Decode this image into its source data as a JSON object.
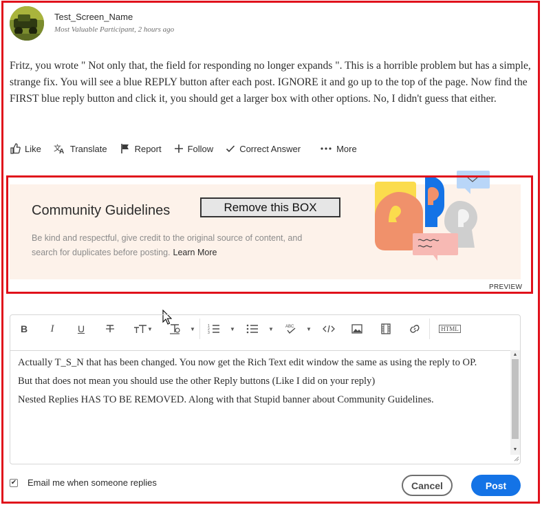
{
  "post": {
    "author": "Test_Screen_Name",
    "rank": "Most Valuable Participant",
    "time": ", 2 hours ago",
    "body": "Fritz, you wrote \" Not only that, the field for responding no longer expands \". This is a horrible problem but has a simple, strange fix. You will see a blue REPLY button after each post. IGNORE it and go up to the top of the page. Now find the FIRST blue reply button and click it, you should get a larger box with other options. No, I didn't guess that either."
  },
  "actions": {
    "like": "Like",
    "translate": "Translate",
    "report": "Report",
    "follow": "Follow",
    "correct_answer": "Correct Answer",
    "more": "More"
  },
  "guidelines": {
    "title": "Community Guidelines",
    "text": "Be kind and respectful, give credit to the original source of content, and search for duplicates before posting.",
    "learn_more": "Learn More",
    "annotation": "Remove this BOX",
    "preview_label": "PREVIEW"
  },
  "toolbar": {
    "bold": "B",
    "italic": "I",
    "underline": "U",
    "html": "HTML"
  },
  "editor": {
    "lines": [
      "Actually T_S_N that has been changed. You now get the Rich Text edit window the same as using the reply to OP.",
      "But that does not mean you should use the other Reply buttons (Like I did on your reply)",
      "Nested Replies HAS TO BE REMOVED. Along with that Stupid banner about Community Guidelines."
    ]
  },
  "footer": {
    "email_label": "Email me when someone replies",
    "email_checked": true,
    "cancel": "Cancel",
    "post": "Post"
  },
  "colors": {
    "annotation_red": "#e0111b",
    "post_blue": "#1473e6",
    "banner_bg": "#fdf2ea"
  }
}
